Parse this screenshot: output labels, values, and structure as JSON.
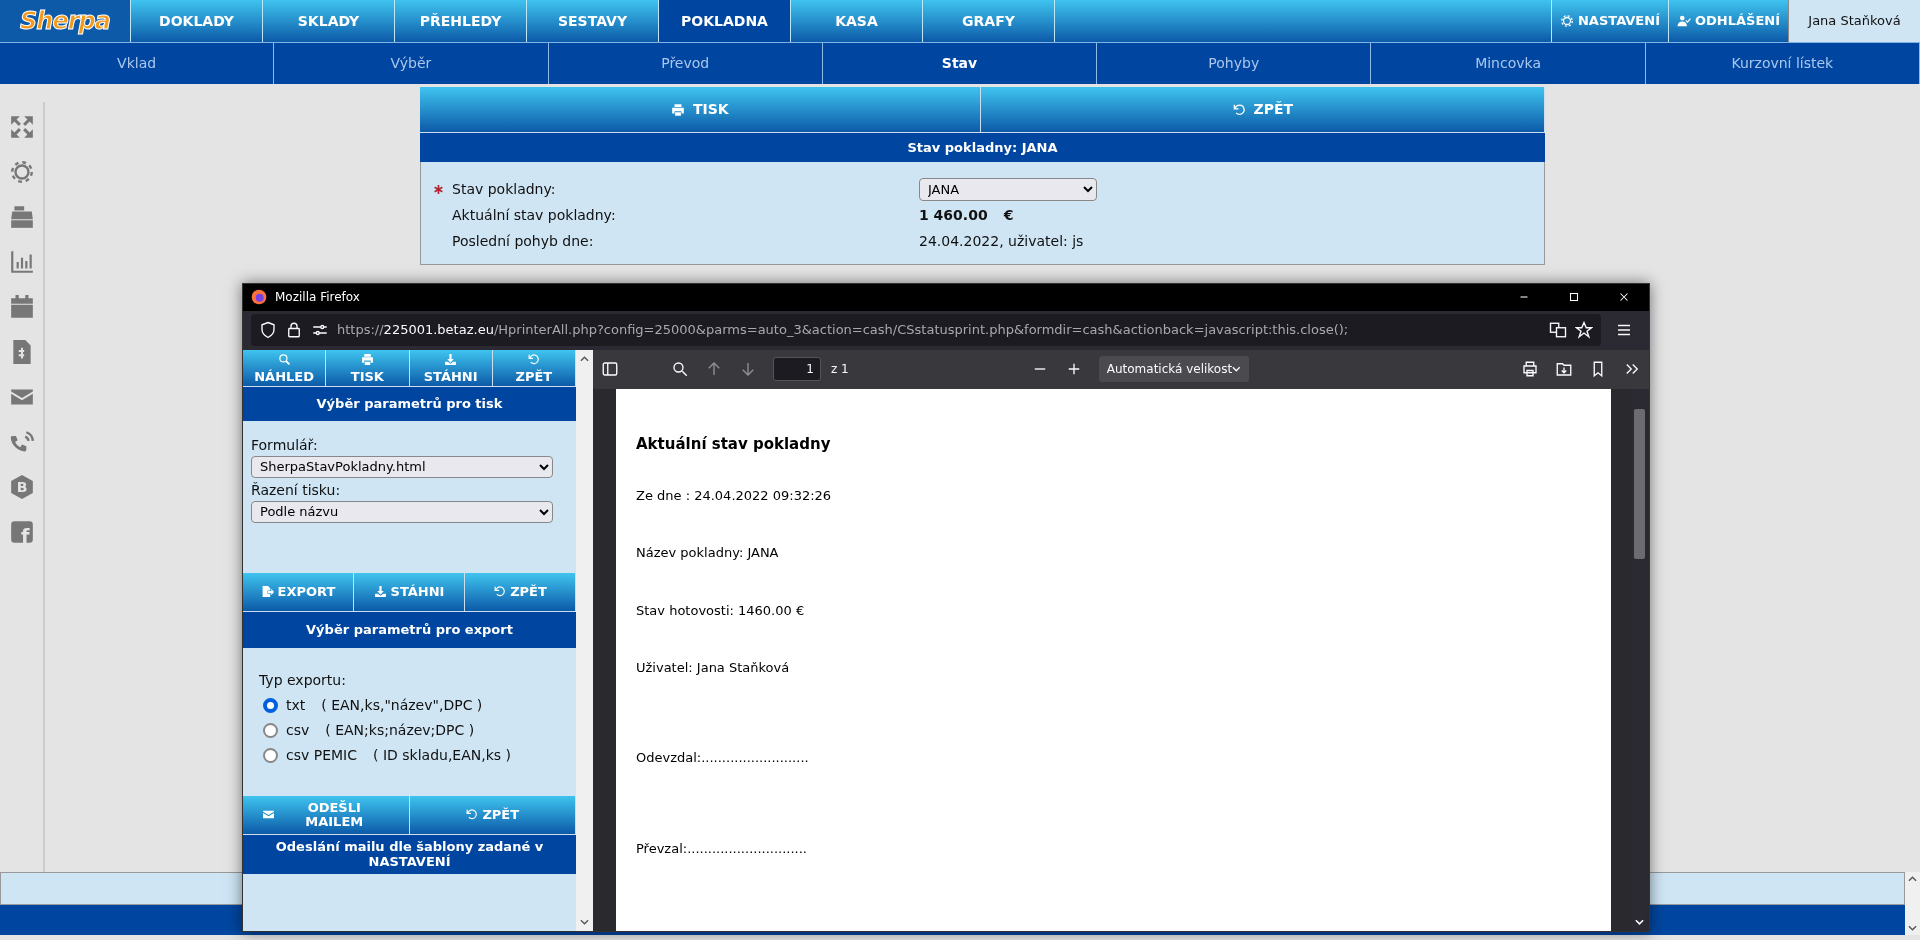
{
  "top_nav": {
    "logo": "Sherpa",
    "items": [
      {
        "label": "DOKLADY",
        "selected": false
      },
      {
        "label": "SKLADY",
        "selected": false
      },
      {
        "label": "PŘEHLEDY",
        "selected": false
      },
      {
        "label": "SESTAVY",
        "selected": false
      },
      {
        "label": "POKLADNA",
        "selected": true
      },
      {
        "label": "KASA",
        "selected": false
      },
      {
        "label": "GRAFY",
        "selected": false
      }
    ],
    "actions": [
      {
        "label": "NASTAVENÍ",
        "kind": "gear"
      },
      {
        "label": "ODHLÁŠENÍ",
        "kind": "user-check"
      }
    ],
    "user": "Jana Staňková"
  },
  "sub_nav": [
    {
      "label": "Vklad",
      "selected": false
    },
    {
      "label": "Výběr",
      "selected": false
    },
    {
      "label": "Převod",
      "selected": false
    },
    {
      "label": "Stav",
      "selected": true
    },
    {
      "label": "Pohyby",
      "selected": false
    },
    {
      "label": "Mincovka",
      "selected": false
    },
    {
      "label": "Kurzovní lístek",
      "selected": false
    }
  ],
  "sidebar": [
    {
      "kind": "expand"
    },
    {
      "kind": "gear"
    },
    {
      "kind": "register"
    },
    {
      "kind": "chart"
    },
    {
      "kind": "calendar"
    },
    {
      "kind": "invoice"
    },
    {
      "kind": "mail"
    },
    {
      "kind": "phone"
    },
    {
      "kind": "letter",
      "glyph": "B"
    },
    {
      "kind": "square-letter",
      "glyph": "f"
    }
  ],
  "panel": {
    "buttons": [
      {
        "label": "TISK",
        "kind": "print"
      },
      {
        "label": "ZPĚT",
        "kind": "undo"
      }
    ],
    "title": "Stav pokladny: JANA",
    "fields": [
      {
        "label": "Stav pokladny:",
        "required": true,
        "kind": "select",
        "value": "JANA"
      },
      {
        "label": "Aktuální stav pokladny:",
        "kind": "amount",
        "value": "1 460.00",
        "currency": "€"
      },
      {
        "label": "Poslední pohyb dne:",
        "kind": "text",
        "value": "24.04.2022, uživatel: js"
      }
    ]
  },
  "browser": {
    "title": "Mozilla Firefox",
    "url": "https://**225001.betaz.eu**/HprinterAll.php?config=25000&parms=auto_3&action=cash/CSstatusprint.php&formdir=cash&actionback=javascript:this.close();",
    "print_buttons": [
      {
        "label": "NÁHLED",
        "kind": "search"
      },
      {
        "label": "TISK",
        "kind": "print"
      },
      {
        "label": "STÁHNI",
        "kind": "download"
      },
      {
        "label": "ZPĚT",
        "kind": "undo"
      }
    ],
    "print_title": "Výběr parametrů pro tisk",
    "print_fields": [
      {
        "label": "Formulář:",
        "value": "SherpaStavPokladny.html"
      },
      {
        "label": "Řazení tisku:",
        "value": "Podle názvu"
      }
    ],
    "export_buttons": [
      {
        "label": "EXPORT",
        "kind": "export"
      },
      {
        "label": "STÁHNI",
        "kind": "download"
      },
      {
        "label": "ZPĚT",
        "kind": "undo"
      }
    ],
    "export_title": "Výběr parametrů pro export",
    "export_label": "Typ exportu:",
    "export_types": [
      {
        "format": "txt",
        "columns": "( EAN,ks,\"název\",DPC )",
        "selected": true
      },
      {
        "format": "csv",
        "columns": "( EAN;ks;název;DPC )",
        "selected": false
      },
      {
        "format": "csv PEMIC",
        "columns": "( ID skladu,EAN,ks )",
        "selected": false
      }
    ],
    "mail_buttons": [
      {
        "label": "ODEŠLI MAILEM",
        "kind": "mail"
      },
      {
        "label": "ZPĚT",
        "kind": "undo"
      }
    ],
    "mail_title": "Odeslání mailu dle šablony zadané v NASTAVENÍ",
    "pdf": {
      "page": "1",
      "page_count": "z 1",
      "zoom": "Automatická velikost",
      "heading": "Aktuální stav pokladny",
      "lines": [
        "Ze dne : 24.04.2022 09:32:26",
        "Název pokladny: JANA",
        "Stav hotovosti: 1460.00 €",
        "Uživatel: Jana Staňková",
        "Odevzdal:..........................",
        "Převzal:............................."
      ]
    }
  }
}
